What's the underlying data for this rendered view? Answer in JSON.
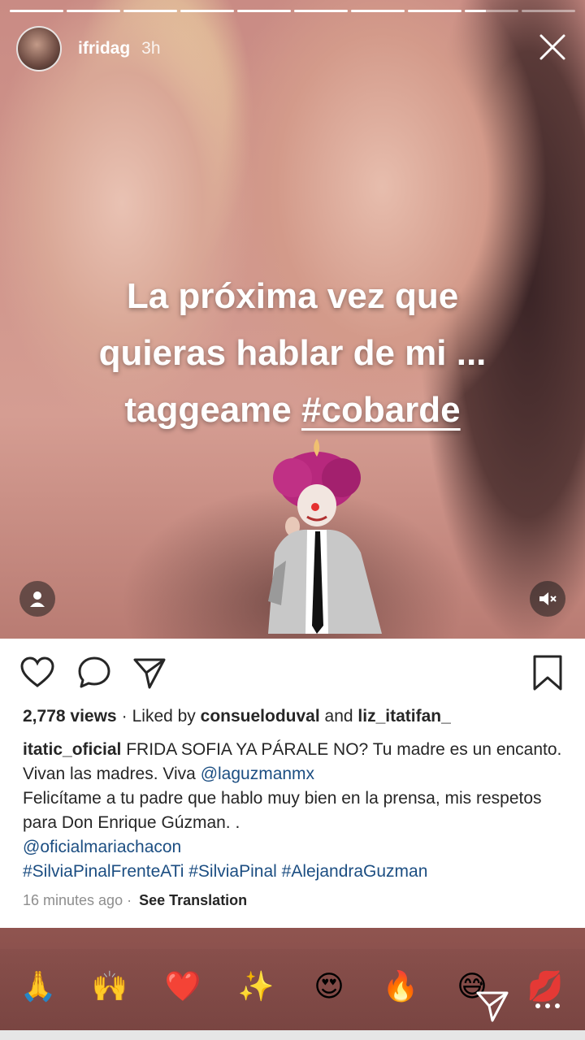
{
  "story": {
    "progress_segments": 10,
    "active_segment": 9,
    "username": "ifridag",
    "time": "3h",
    "overlay_lines": [
      "La próxima vez que",
      "quieras hablar de mi ...",
      "taggeame"
    ],
    "overlay_hashtag": "#cobarde"
  },
  "post": {
    "views": "2,778 views",
    "dot": "·",
    "liked_by_prefix": "Liked by",
    "liker_1": "consueloduval",
    "and_text": "and",
    "liker_2": "liz_itatifan_",
    "caption_user": "itatic_oficial",
    "caption_text_1": "FRIDA SOFIA YA PÁRALE NO? Tu madre es un encanto. Vivan las madres. Viva",
    "caption_mention_1": "@laguzmanmx",
    "caption_text_2": "Felicítame a tu padre que hablo muy bien en la prensa, mis respetos para Don Enrique Gúzman. .",
    "caption_mention_2": "@oficialmariachacon",
    "hashtags": "#SilviaPinalFrenteATi #SilviaPinal #AlejandraGuzman",
    "time_ago": "16 minutes ago",
    "meta_dot": "·",
    "see_translation": "See Translation"
  },
  "reactions": [
    {
      "name": "folded-hands-emoji",
      "glyph": "🙏"
    },
    {
      "name": "raised-hands-emoji",
      "glyph": "🙌"
    },
    {
      "name": "heart-emoji",
      "glyph": "❤️"
    },
    {
      "name": "sparkles-emoji",
      "glyph": "✨"
    },
    {
      "name": "heart-eyes-emoji",
      "glyph": "😍"
    },
    {
      "name": "fire-emoji",
      "glyph": "🔥"
    },
    {
      "name": "grinning-sweat-emoji",
      "glyph": "😅"
    },
    {
      "name": "kiss-mark-emoji",
      "glyph": "💋"
    }
  ],
  "icons": {
    "close": "close-icon",
    "profile": "person-icon",
    "mute": "speaker-muted-icon",
    "heart": "heart-outline-icon",
    "comment": "comment-bubble-icon",
    "share": "paper-plane-icon",
    "bookmark": "bookmark-icon",
    "send": "send-icon",
    "more": "more-dots-icon"
  },
  "colors": {
    "link": "#1c4e82",
    "text": "#262626",
    "muted": "#8e8e8e"
  }
}
